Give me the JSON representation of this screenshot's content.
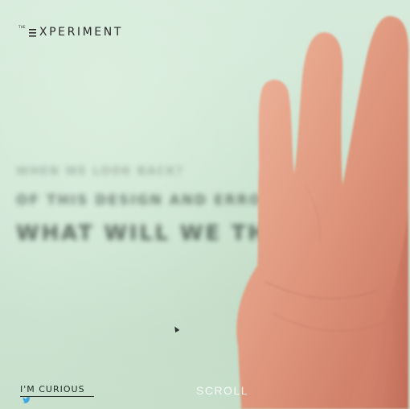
{
  "brand": {
    "small": "THE",
    "word": "XPERIMENT"
  },
  "headline": {
    "line1": "WHEN WE LOOK BACK?",
    "line2": "OF THIS DESIGN AND ERROR",
    "line3": "WHAT WILL WE THINK"
  },
  "footer": {
    "curious_label": "I'M CURIOUS",
    "scroll_label": "SCROLL",
    "twitter_icon": "twitter-bird-icon"
  },
  "colors": {
    "background": "#cfe4d2",
    "text_dark": "#2b2b2b",
    "twitter_blue": "#3aa7e3"
  }
}
